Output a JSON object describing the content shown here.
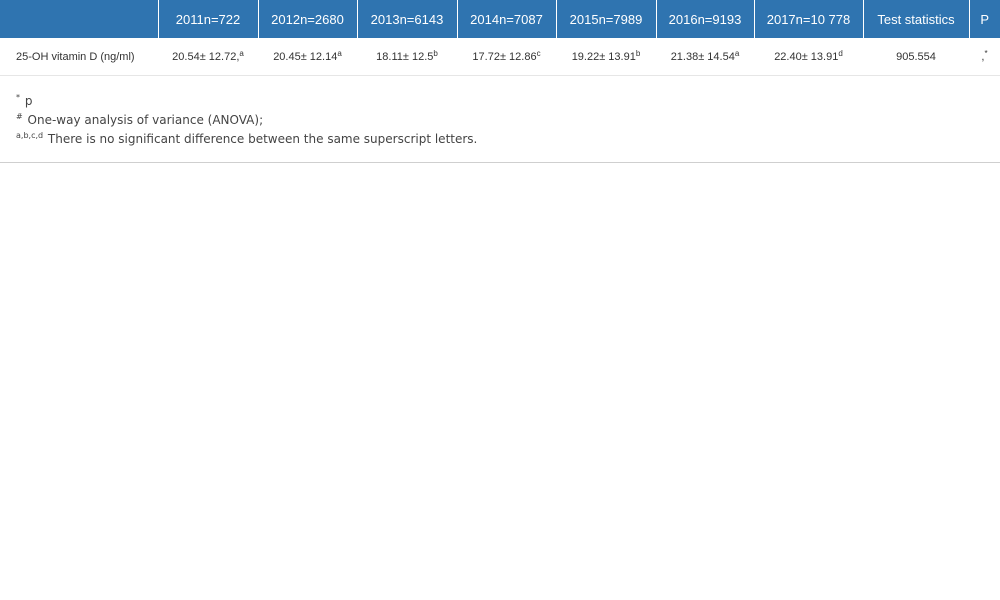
{
  "table": {
    "header": {
      "blank": "",
      "columns": [
        "2011n=722",
        "2012n=2680",
        "2013n=6143",
        "2014n=7087",
        "2015n=7989",
        "2016n=9193",
        "2017n=10 778",
        "Test statistics",
        "P"
      ]
    },
    "row": {
      "label": "25-OH vitamin D (ng/ml)",
      "cells": [
        {
          "value": "20.54± 12.72,",
          "sup": "a"
        },
        {
          "value": "20.45± 12.14",
          "sup": "a"
        },
        {
          "value": "18.11± 12.5",
          "sup": "b"
        },
        {
          "value": "17.72± 12.86",
          "sup": "c"
        },
        {
          "value": "19.22± 13.91",
          "sup": "b"
        },
        {
          "value": "21.38± 14.54",
          "sup": "a"
        },
        {
          "value": "22.40± 13.91",
          "sup": "d"
        },
        {
          "value": "905.554",
          "sup": ""
        },
        {
          "value": ",",
          "sup": "*"
        }
      ]
    }
  },
  "footnotes": [
    {
      "mark": "*",
      "text": "p"
    },
    {
      "mark": "#",
      "text": "One-way analysis of variance (ANOVA);"
    },
    {
      "mark": "a,b,c,d",
      "text": "There is no significant difference between the same superscript letters."
    }
  ],
  "colors": {
    "header_bg": "#2f74b0",
    "header_text": "#ffffff"
  }
}
